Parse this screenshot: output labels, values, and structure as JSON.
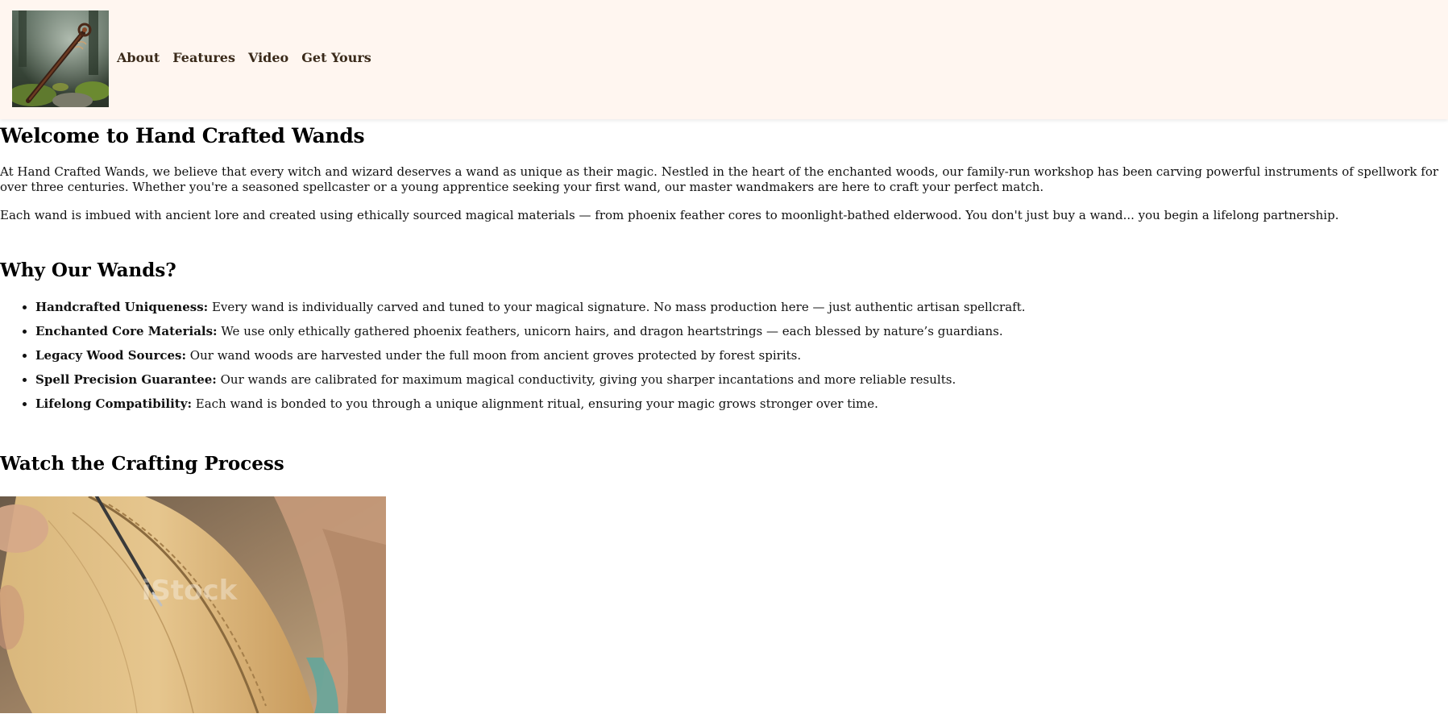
{
  "header": {
    "logo_alt": "Hand Crafted Wands logo",
    "nav": [
      {
        "label": "About"
      },
      {
        "label": "Features"
      },
      {
        "label": "Video"
      },
      {
        "label": "Get Yours"
      }
    ]
  },
  "about": {
    "title": "Welcome to Hand Crafted Wands",
    "para1": "At Hand Crafted Wands, we believe that every witch and wizard deserves a wand as unique as their magic. Nestled in the heart of the enchanted woods, our family-run workshop has been carving powerful instruments of spellwork for over three centuries. Whether you're a seasoned spellcaster or a young apprentice seeking your first wand, our master wandmakers are here to craft your perfect match.",
    "para2": "Each wand is imbued with ancient lore and created using ethically sourced magical materials — from phoenix feather cores to moonlight-bathed elderwood. You don't just buy a wand... you begin a lifelong partnership."
  },
  "features": {
    "title": "Why Our Wands?",
    "items": [
      {
        "name": "Handcrafted Uniqueness:",
        "text": " Every wand is individually carved and tuned to your magical signature. No mass production here — just authentic artisan spellcraft."
      },
      {
        "name": "Enchanted Core Materials:",
        "text": " We use only ethically gathered phoenix feathers, unicorn hairs, and dragon heartstrings — each blessed by nature’s guardians."
      },
      {
        "name": "Legacy Wood Sources:",
        "text": " Our wand woods are harvested under the full moon from ancient groves protected by forest spirits."
      },
      {
        "name": "Spell Precision Guarantee:",
        "text": " Our wands are calibrated for maximum magical conductivity, giving you sharper incantations and more reliable results."
      },
      {
        "name": "Lifelong Compatibility:",
        "text": " Each wand is bonded to you through a unique alignment ritual, ensuring your magic grows stronger over time."
      }
    ]
  },
  "video": {
    "title": "Watch the Crafting Process",
    "watermark": "iStock"
  },
  "colors": {
    "header_bg": "#fff6f0",
    "nav_text": "#3a2a1a"
  }
}
